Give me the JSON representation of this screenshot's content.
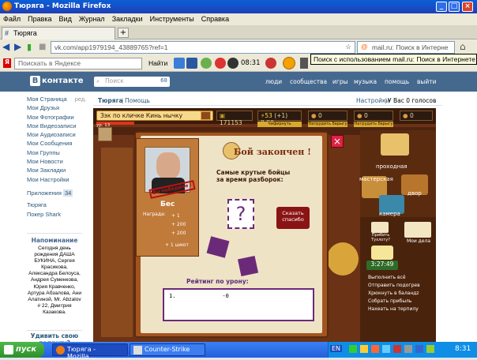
{
  "window": {
    "title": "Тюряга - Mozilla Firefox",
    "buttons": [
      "_",
      "□",
      "×"
    ]
  },
  "menu": [
    "Файл",
    "Правка",
    "Вид",
    "Журнал",
    "Закладки",
    "Инструменты",
    "Справка"
  ],
  "tab": {
    "label": "Тюряга",
    "new": "+"
  },
  "nav": {
    "url": "vk.com/app1979194_43889765?ref=1",
    "search_placeholder": "mail.ru: Поиск в Интерне"
  },
  "yandex": {
    "search": "Поискать в Яндексе",
    "find": "Найти",
    "time": "08:31"
  },
  "tooltip": "Поиск с использованием mail.ru: Поиск в Интернете",
  "vk": {
    "logo": "контакте",
    "logo_letter": "В",
    "search": "Поиск",
    "nav": [
      "люди",
      "сообщества",
      "игры",
      "музыка",
      "помощь",
      "выйти"
    ],
    "left_menu": [
      "Моя Страница",
      "Мои Друзья",
      "Мои Фотографии",
      "Мои Видеозаписи",
      "Мои Аудиозаписи",
      "Мои Сообщения",
      "Мои Группы",
      "Мои Новости",
      "Мои Закладки",
      "Мои Настройки"
    ],
    "edit": "ред.",
    "apps": "Приложения",
    "apps_count": "34",
    "app_links": [
      "Тюряга",
      "Покер Shark"
    ],
    "reminder_title": "Напоминание",
    "reminder_text": "Сегодня день рождения ДАША БУКИНА, Сергея Красикова, Александра Белоуса, Андрея Суменкова, Юрия Кравченко, Артура Абзалова, Ани Алатиной, Мг. Abzalov # 22, Дмитрия Казакова.",
    "promo": "Удивить свою подругу?",
    "app_title": "Тюряга",
    "help": "Помощь",
    "settings": "Настройки",
    "votes": "У Вас 0 голосов"
  },
  "game": {
    "status": "Зэк по кличке Кинь нычку",
    "level": "ур. 13",
    "money": "171153",
    "energy": "53",
    "energy_plus": "(+1) 0:00",
    "res1": "0",
    "res2": "0",
    "res3": "0",
    "btn1": "Чифирнуть",
    "btn2": "Натрудить барыгу",
    "btn3": "Натрудить барыгу",
    "popup_title": "Бой закончен !",
    "fighter_name": "Бес",
    "stamp": "Вы победили !",
    "reward_label": "Награда:",
    "rewards": [
      "+ 1",
      "+ 200",
      "+ 200",
      "+ 1 шмот"
    ],
    "fighters_title": "Самые крутые бойцы за время разборок:",
    "thank_btn": "Сказать спасибо",
    "rating_title": "Рейтинг по урону:",
    "rating_row": "1.              -0",
    "rooms": [
      "проходная",
      "мастерская",
      "двор",
      "камера"
    ],
    "timer": "3:27:49",
    "tasks": [
      "Выполнить всё",
      "Отправить подогрев",
      "Хрюкнуть в баландz",
      "Собрать прибыль",
      "Нахеать на терпилу"
    ],
    "side_items": [
      "Прибить Тухлоту?",
      "Мои дела"
    ]
  },
  "taskbar": {
    "start": "пуск",
    "items": [
      "Тюряга - Mozilla...",
      "Counter-Strike"
    ],
    "lang": "EN",
    "clock": "8:31"
  }
}
